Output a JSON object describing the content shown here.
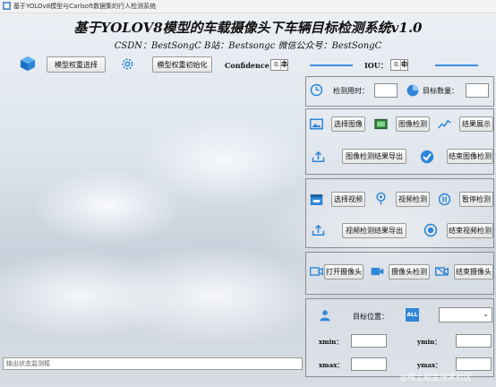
{
  "window": {
    "title": "基于YOLOv8模型与Carlsoft数据集的行人检测系统"
  },
  "header": {
    "title": "基于YOLOV8模型的车载摄像头下车辆目标检测系统v1.0",
    "subtitle": "CSDN：BestSongC   B站：Bestsongc   微信公众号：BestSongC"
  },
  "toolbar": {
    "select_weights": "模型权重选择",
    "init_weights": "模型权重初始化",
    "confidence_label": "Confidence",
    "confidence_value": "0.25",
    "iou_label": "IOU：",
    "iou_value": "0.40"
  },
  "stats": {
    "time_label": "检测用时：",
    "count_label": "目标数量："
  },
  "image_section": {
    "select": "选择图像",
    "detect": "图像检测",
    "show": "结果展示",
    "export": "图像检测结果导出",
    "stop": "结束图像检测"
  },
  "video_section": {
    "select": "选择视频",
    "detect": "视频检测",
    "pause": "暂停检测",
    "export": "视频检测结果导出",
    "stop": "结束视频检测"
  },
  "camera_section": {
    "open": "打开摄像头",
    "detect": "摄像头检测",
    "stop": "结束摄像头"
  },
  "target_section": {
    "position_label": "目标位置：",
    "all_icon_text": "ALL",
    "xmin": "xmin：",
    "ymin": "ymin：",
    "xmax": "xmax：",
    "ymax": "ymax："
  },
  "status_bar": {
    "placeholder": "输出状态监测框"
  },
  "watermark": "@稀土掘金技术社区",
  "colors": {
    "accent": "#2f86d6",
    "slider": "#3d8ee0"
  }
}
